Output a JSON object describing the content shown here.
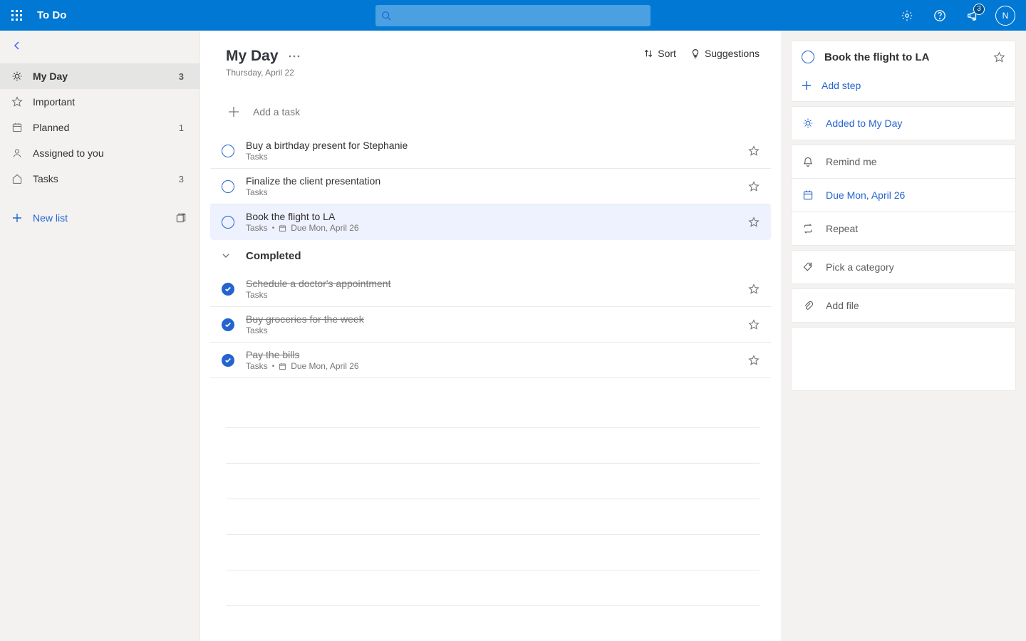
{
  "header": {
    "app_name": "To Do",
    "feedback_badge": "3",
    "avatar_initial": "N"
  },
  "sidebar": {
    "items": [
      {
        "label": "My Day",
        "count": "3",
        "icon": "sun"
      },
      {
        "label": "Important",
        "count": "",
        "icon": "star"
      },
      {
        "label": "Planned",
        "count": "1",
        "icon": "calendar"
      },
      {
        "label": "Assigned to you",
        "count": "",
        "icon": "person"
      },
      {
        "label": "Tasks",
        "count": "3",
        "icon": "home"
      }
    ],
    "new_list_label": "New list"
  },
  "main": {
    "title": "My Day",
    "date": "Thursday, April 22",
    "sort_label": "Sort",
    "suggestions_label": "Suggestions",
    "add_task_placeholder": "Add a task",
    "completed_label": "Completed",
    "tasks": [
      {
        "title": "Buy a birthday present for Stephanie",
        "list": "Tasks",
        "due": "",
        "completed": false,
        "selected": false
      },
      {
        "title": "Finalize the client presentation",
        "list": "Tasks",
        "due": "",
        "completed": false,
        "selected": false
      },
      {
        "title": "Book the flight to LA",
        "list": "Tasks",
        "due": "Due Mon, April 26",
        "completed": false,
        "selected": true
      }
    ],
    "completed_tasks": [
      {
        "title": "Schedule a doctor's appointment",
        "list": "Tasks",
        "due": "",
        "completed": true
      },
      {
        "title": "Buy groceries for the week",
        "list": "Tasks",
        "due": "",
        "completed": true
      },
      {
        "title": "Pay the bills",
        "list": "Tasks",
        "due": "Due Mon, April 26",
        "completed": true
      }
    ]
  },
  "details": {
    "title": "Book the flight to LA",
    "add_step_label": "Add step",
    "added_my_day_label": "Added to My Day",
    "remind_label": "Remind me",
    "due_label": "Due Mon, April 26",
    "repeat_label": "Repeat",
    "category_label": "Pick a category",
    "add_file_label": "Add file"
  }
}
